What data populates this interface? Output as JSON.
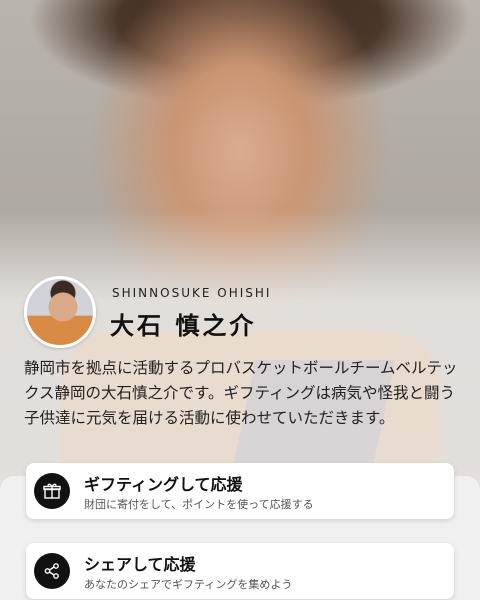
{
  "player": {
    "name_en": "SHINNOSUKE OHISHI",
    "name_jp": "大石 慎之介",
    "description": "静岡市を拠点に活動するプロバスケットボールチームベルテックス静岡の大石慎之介です。ギフティングは病気や怪我と闘う子供達に元気を届ける活動に使わせていただきます。"
  },
  "actions": {
    "gift": {
      "icon": "gift-icon",
      "title": "ギフティングして応援",
      "subtitle": "財団に寄付をして、ポイントを使って応援する"
    },
    "share": {
      "icon": "share-icon",
      "title": "シェアして応援",
      "subtitle": "あなたのシェアでギフティングを集めよう"
    }
  },
  "colors": {
    "icon_circle": "#111111",
    "card_bg": "#ffffff",
    "page_bg": "#f0f0f0"
  }
}
